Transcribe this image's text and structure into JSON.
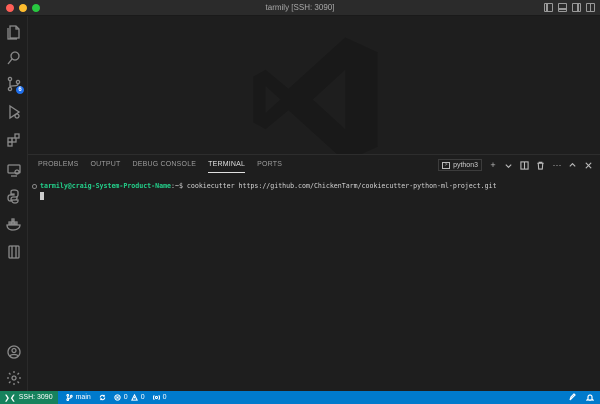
{
  "window": {
    "title": "tarmily [SSH: 3090]"
  },
  "activity_bar": {
    "icons": [
      "files-icon",
      "search-icon",
      "source-control-icon",
      "run-debug-icon",
      "extensions-icon",
      "remote-explorer-icon",
      "python-icon",
      "docker-icon",
      "testing-icon",
      "account-icon",
      "settings-gear-icon"
    ],
    "source_control_badge": "6"
  },
  "panel": {
    "tabs": [
      {
        "label": "PROBLEMS",
        "active": false
      },
      {
        "label": "OUTPUT",
        "active": false
      },
      {
        "label": "DEBUG CONSOLE",
        "active": false
      },
      {
        "label": "TERMINAL",
        "active": true
      },
      {
        "label": "PORTS",
        "active": false
      }
    ],
    "terminal_name": "python3",
    "terminal": {
      "prompt": "tarmily@craig-System-Product-Name",
      "path_sep": ":~$",
      "command": " cookiecutter https://github.com/ChickenTarm/cookiecutter-python-ml-project.git"
    }
  },
  "status_bar": {
    "remote": "SSH: 3090",
    "branch": "main",
    "errors": "0",
    "warnings": "0",
    "ports": "0"
  },
  "colors": {
    "status_bar": "#007acc",
    "remote": "#16825d",
    "prompt": "#23d18b"
  }
}
